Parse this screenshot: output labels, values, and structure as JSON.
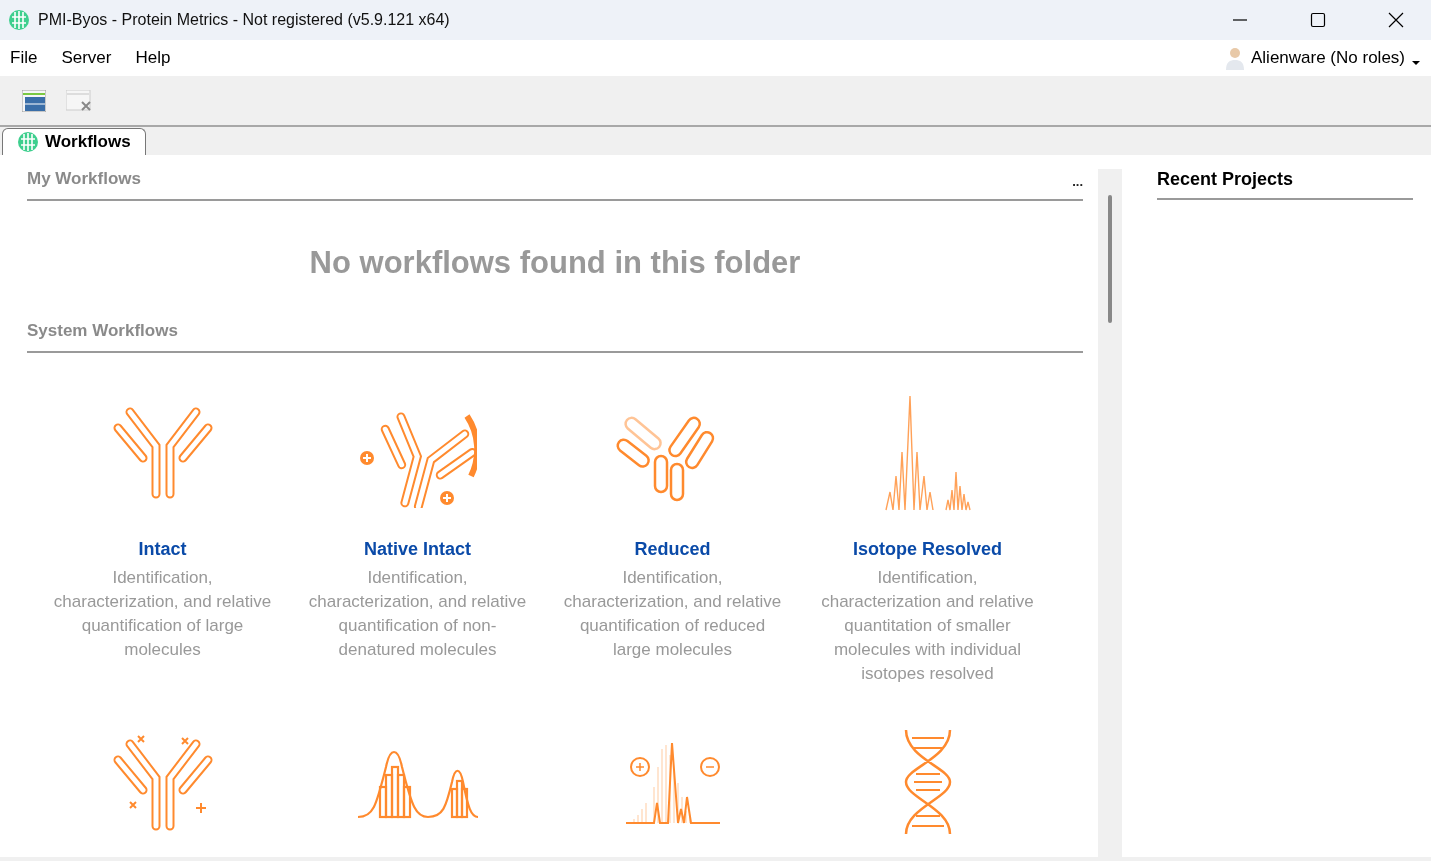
{
  "window": {
    "title": "PMI-Byos - Protein Metrics - Not registered (v5.9.121 x64)"
  },
  "menu": [
    "File",
    "Server",
    "Help"
  ],
  "user": {
    "label": "Alienware (No roles)"
  },
  "tabs": [
    {
      "label": "Workflows",
      "selected": true
    }
  ],
  "my_workflows": {
    "title": "My Workflows",
    "more": "...",
    "empty_message": "No workflows found in this folder"
  },
  "system_workflows": {
    "title": "System Workflows",
    "items": [
      {
        "kind": "antibody",
        "title": "Intact",
        "description": "Identification, characterization, and relative quantification of large molecules"
      },
      {
        "kind": "native",
        "title": "Native Intact",
        "description": "Identification, characterization, and relative quantification of non-denatured molecules"
      },
      {
        "kind": "reduced",
        "title": "Reduced",
        "description": "Identification, characterization, and relative quantification of reduced large molecules"
      },
      {
        "kind": "isotope",
        "title": "Isotope Resolved",
        "description": "Identification, characterization and relative quantitation of smaller molecules with individual isotopes resolved"
      },
      {
        "kind": "modified"
      },
      {
        "kind": "peaks"
      },
      {
        "kind": "charge"
      },
      {
        "kind": "dna"
      }
    ]
  },
  "recent_projects": {
    "title": "Recent Projects"
  }
}
